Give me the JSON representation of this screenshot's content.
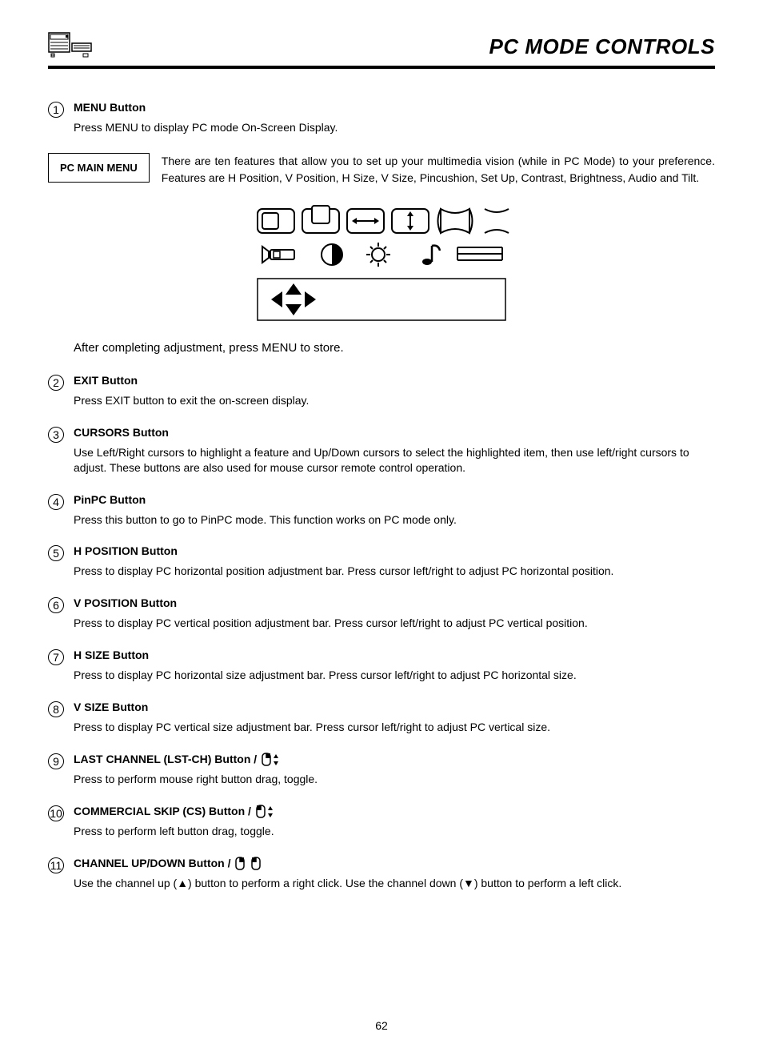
{
  "page": {
    "title": "PC MODE CONTROLS",
    "number": "62"
  },
  "items": [
    {
      "num": "1",
      "title": "MENU Button",
      "body": "Press MENU to display PC mode On-Screen Display."
    },
    {
      "num": "2",
      "title": "EXIT Button",
      "body": "Press EXIT button to exit the on-screen display."
    },
    {
      "num": "3",
      "title": "CURSORS Button",
      "body": "Use Left/Right cursors to highlight a feature and Up/Down cursors to select the highlighted item, then use left/right cursors to adjust. These buttons are also used for mouse cursor remote control operation."
    },
    {
      "num": "4",
      "title": "PinPC Button",
      "body": "Press this button to go to PinPC mode.  This function works on PC mode only."
    },
    {
      "num": "5",
      "title": "H POSITION Button",
      "body": "Press to display PC horizontal position adjustment bar. Press cursor left/right to adjust PC horizontal position."
    },
    {
      "num": "6",
      "title": "V POSITION Button",
      "body": "Press to display PC vertical position adjustment bar. Press cursor left/right to adjust PC vertical position."
    },
    {
      "num": "7",
      "title": "H SIZE Button",
      "body": "Press to display PC horizontal size adjustment bar. Press cursor left/right to adjust PC horizontal size."
    },
    {
      "num": "8",
      "title": "V SIZE Button",
      "body": "Press to display PC vertical size adjustment bar. Press cursor left/right to adjust PC vertical size."
    },
    {
      "num": "9",
      "title": "LAST CHANNEL (LST-CH) Button / ",
      "body": "Press to perform mouse right button drag, toggle."
    },
    {
      "num": "10",
      "title": "COMMERCIAL SKIP (CS) Button / ",
      "body": "Press to perform left button drag, toggle."
    },
    {
      "num": "11",
      "title": "CHANNEL UP/DOWN Button / ",
      "body": "Use the channel up (▲) button to perform a right click. Use the channel down (▼) button to perform a left click."
    }
  ],
  "menuBox": {
    "label": "PC MAIN MENU",
    "desc": "There are ten features that allow you to set up your multimedia vision (while in PC Mode) to your preference. Features are H Position, V Position, H Size, V Size, Pincushion, Set Up, Contrast, Brightness, Audio and Tilt."
  },
  "afterNote": "After completing adjustment, press MENU to store."
}
